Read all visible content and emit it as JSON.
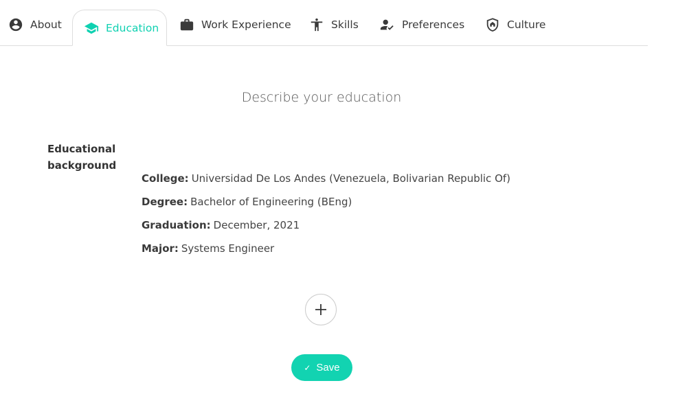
{
  "tabs": [
    {
      "label": "About",
      "icon": "account-circle-icon"
    },
    {
      "label": "Education",
      "icon": "graduation-cap-icon",
      "active": true
    },
    {
      "label": "Work Experience",
      "icon": "briefcase-icon"
    },
    {
      "label": "Skills",
      "icon": "accessibility-icon"
    },
    {
      "label": "Preferences",
      "icon": "person-check-icon"
    },
    {
      "label": "Culture",
      "icon": "shield-home-icon"
    }
  ],
  "main": {
    "heading": "Describe your education",
    "section_label": "Educational background",
    "education": {
      "college_key": "College:",
      "college": "Universidad De Los Andes (Venezuela, Bolivarian Republic Of)",
      "degree_key": "Degree:",
      "degree": "Bachelor of Engineering (BEng)",
      "graduation_key": "Graduation:",
      "graduation": "December, 2021",
      "major_key": "Major:",
      "major": "Systems Engineer"
    },
    "add_label": "+",
    "save_label": "Save",
    "save_check": "✓"
  },
  "colors": {
    "accent": "#12d3b1",
    "text": "#333333",
    "border": "#dddddd"
  }
}
